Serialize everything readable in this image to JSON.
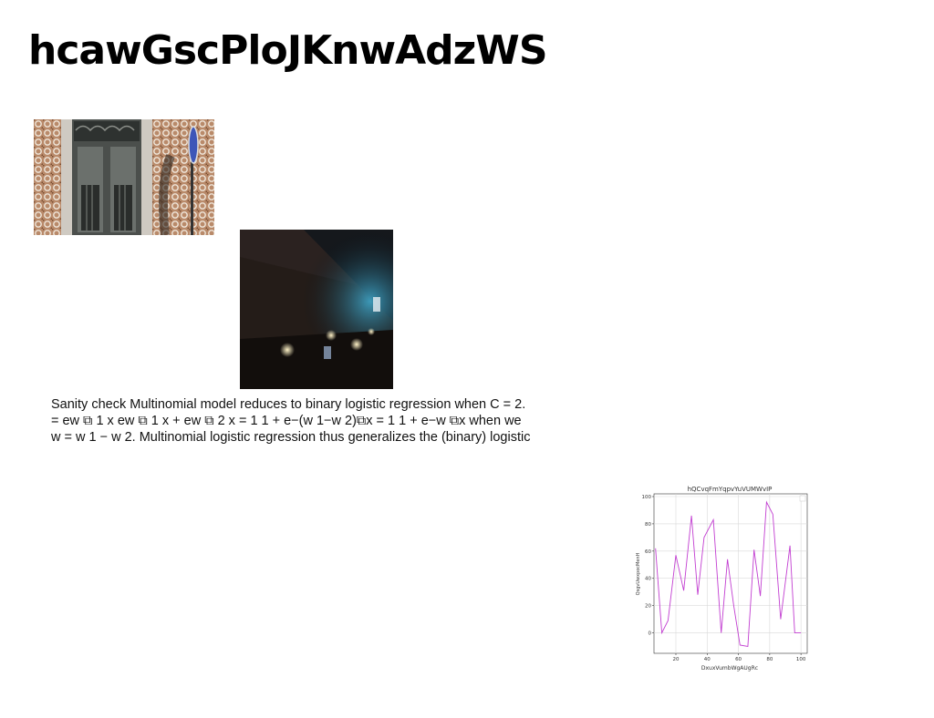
{
  "page": {
    "title": "hcawGscPloJKnwAdzWS"
  },
  "images": [
    {
      "description": "Ornate door with tiled wall and blue street sign"
    },
    {
      "description": "Dark underground tunnel with lights"
    }
  ],
  "text": {
    "lines": [
      "Sanity check Multinomial model reduces to binary logistic regression when C = 2.",
      "= ew ⧉ 1 x ew ⧉ 1 x + ew ⧉ 2 x = 1 1 + e−(w 1−w 2)⧉x = 1 1 + e−w ⧉x when we",
      "w = w 1 − w 2. Multinomial logistic regression thus generalizes the (binary) logistic"
    ]
  },
  "colors": {
    "line": "#c23ed1",
    "grid": "#d9d9d9",
    "axis": "#333333"
  },
  "chart_data": {
    "type": "line",
    "title": "hQCvqFmYqpvYuVUMWvIP",
    "xlabel": "DxuxVumbWgAUgRc",
    "ylabel": "QsgvUwxpocMenH",
    "xlim": [
      6,
      104
    ],
    "ylim": [
      -15,
      102
    ],
    "xticks": [
      20,
      40,
      60,
      80,
      100
    ],
    "yticks": [
      0,
      20,
      40,
      60,
      80,
      100
    ],
    "grid": true,
    "x": [
      7,
      11,
      15,
      20,
      25,
      30,
      34,
      38,
      44,
      49,
      53,
      57,
      61,
      66,
      70,
      74,
      78,
      82,
      87,
      93,
      96,
      100
    ],
    "values": [
      62,
      0,
      9,
      57,
      31,
      86,
      28,
      70,
      83,
      0,
      54,
      20,
      -9,
      -10,
      61,
      27,
      96,
      87,
      10,
      64,
      0,
      0
    ]
  }
}
